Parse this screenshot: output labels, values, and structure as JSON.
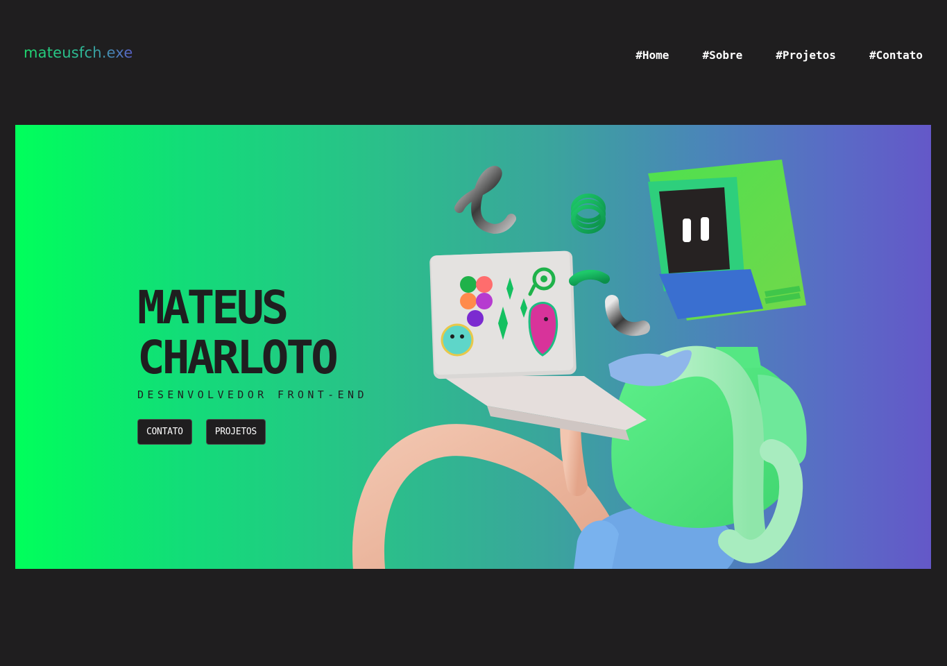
{
  "header": {
    "logo": "mateusfch.exe",
    "nav": [
      {
        "label": "#Home"
      },
      {
        "label": "#Sobre"
      },
      {
        "label": "#Projetos"
      },
      {
        "label": "#Contato"
      }
    ]
  },
  "hero": {
    "name_line1": "MATEUS",
    "name_line2": "CHARLOTO",
    "role": "DESENVOLVEDOR FRONT-END",
    "buttons": {
      "contact": "CONTATO",
      "projects": "PROJETOS"
    },
    "gradient": [
      "#00ff5b",
      "#2bbf8a",
      "#6458c8"
    ]
  },
  "colors": {
    "background": "#1f1e1f",
    "text_dark": "#1f1e1f",
    "nav_text": "#ffffff"
  },
  "illustration": {
    "subject": "3d-character-monitor-head-with-laptop"
  }
}
